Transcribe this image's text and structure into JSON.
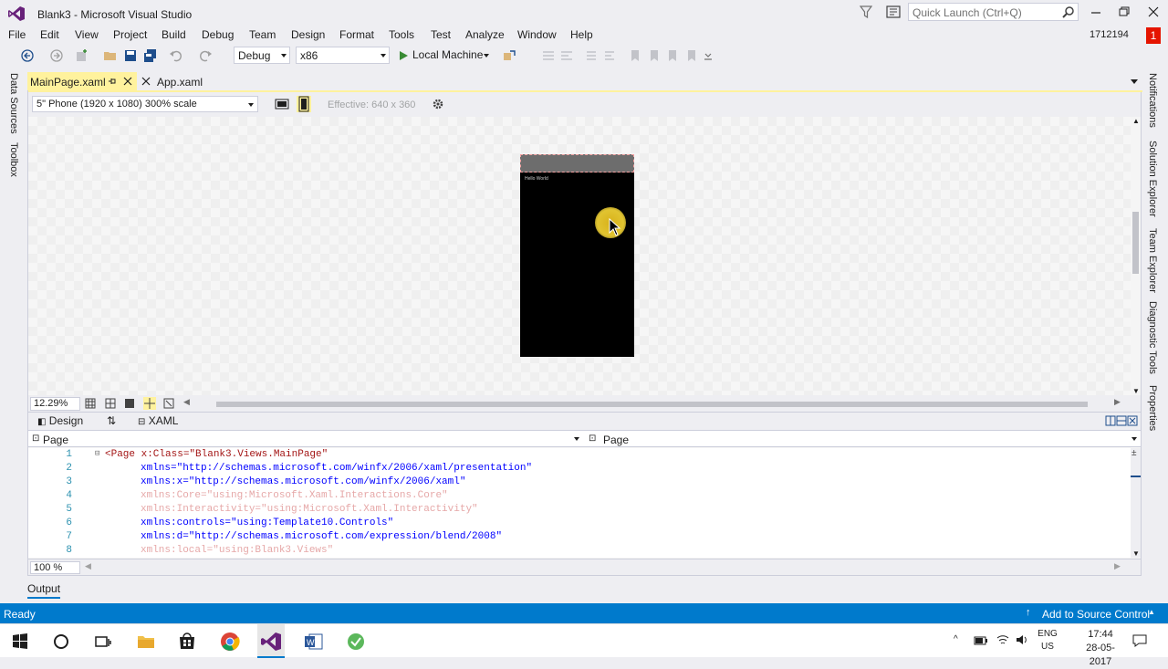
{
  "window": {
    "title": "Blank3 - Microsoft Visual Studio",
    "quick_launch_placeholder": "Quick Launch (Ctrl+Q)",
    "user_id": "1712194",
    "notification_count": "1"
  },
  "menu": [
    "File",
    "Edit",
    "View",
    "Project",
    "Build",
    "Debug",
    "Team",
    "Design",
    "Format",
    "Tools",
    "Test",
    "Analyze",
    "Window",
    "Help"
  ],
  "toolbar": {
    "configuration": "Debug",
    "platform": "x86",
    "run_target": "Local Machine"
  },
  "left_rail": [
    "Data Sources",
    "Toolbox"
  ],
  "right_rail": [
    "Notifications",
    "Solution Explorer",
    "Team Explorer",
    "Diagnostic Tools",
    "Properties"
  ],
  "tabs": [
    {
      "label": "MainPage.xaml",
      "active": true
    },
    {
      "label": "App.xaml",
      "active": false
    }
  ],
  "designer": {
    "device": "5\" Phone (1920 x 1080) 300% scale",
    "effective": "Effective: 640 x 360",
    "zoom": "12.29%",
    "phone_text": "Hello World"
  },
  "split": {
    "design_label": "Design",
    "xaml_label": "XAML"
  },
  "nav": {
    "left": "Page",
    "right": "Page"
  },
  "code_lines": [
    {
      "num": "1",
      "text": "<Page x:Class=\"Blank3.Views.MainPage\""
    },
    {
      "num": "2",
      "text": "xmlns=\"http://schemas.microsoft.com/winfx/2006/xaml/presentation\""
    },
    {
      "num": "3",
      "text": "xmlns:x=\"http://schemas.microsoft.com/winfx/2006/xaml\""
    },
    {
      "num": "4",
      "text": "xmlns:Core=\"using:Microsoft.Xaml.Interactions.Core\""
    },
    {
      "num": "5",
      "text": "xmlns:Interactivity=\"using:Microsoft.Xaml.Interactivity\""
    },
    {
      "num": "6",
      "text": "xmlns:controls=\"using:Template10.Controls\""
    },
    {
      "num": "7",
      "text": "xmlns:d=\"http://schemas.microsoft.com/expression/blend/2008\""
    },
    {
      "num": "8",
      "text": "xmlns:local=\"using:Blank3.Views\""
    }
  ],
  "editor_zoom": "100 %",
  "output_label": "Output",
  "status": {
    "left": "Ready",
    "right": "Add to Source Control"
  },
  "tray": {
    "lang_top": "ENG",
    "lang_bottom": "US",
    "time": "17:44",
    "date": "28-05-2017"
  },
  "colors": {
    "accent": "#007acc",
    "active_tab": "#fff29d",
    "badge": "#e51400"
  }
}
